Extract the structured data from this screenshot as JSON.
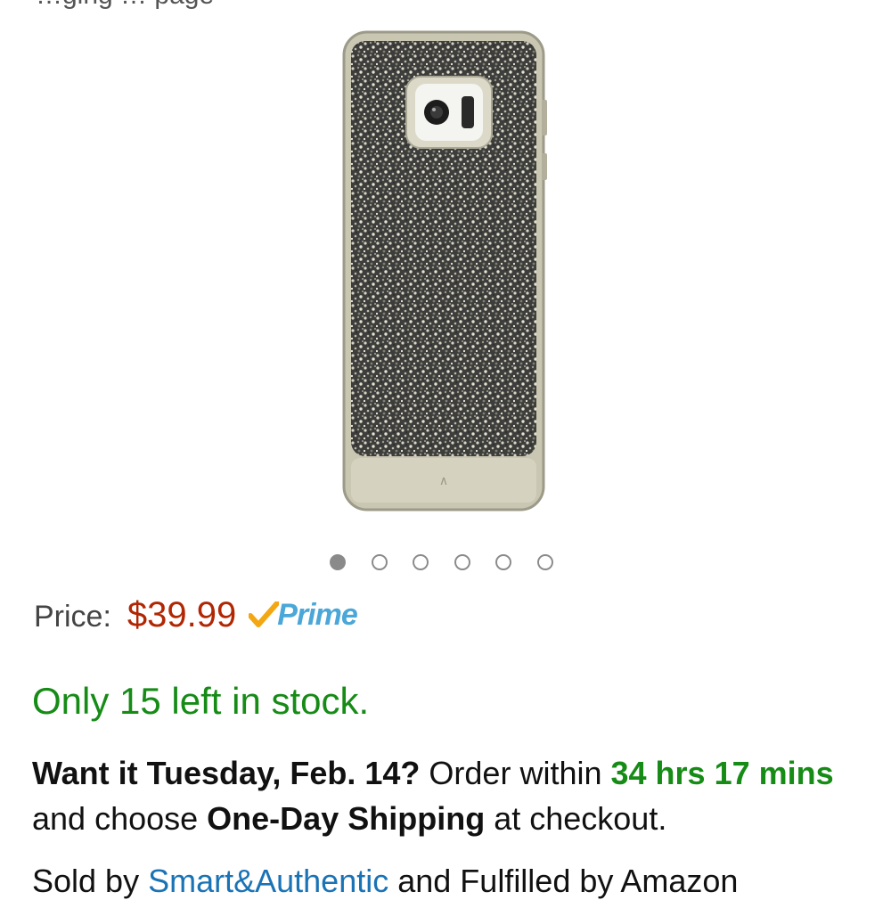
{
  "top_text": "…ging … page",
  "gallery": {
    "image_alt": "Glitter phone case",
    "dots": [
      true,
      false,
      false,
      false,
      false,
      false
    ]
  },
  "price": {
    "label": "Price:",
    "value": "$39.99",
    "badge": "Prime",
    "badge_color": "#4aa7d8",
    "price_color": "#B12704"
  },
  "stock": {
    "text": "Only 15 left in stock.",
    "color": "#168b16"
  },
  "delivery": {
    "want": "Want it Tuesday, Feb. 14?",
    "order_within": "Order within",
    "countdown_hrs": "34 hrs 17",
    "countdown_mins": "mins",
    "choose": "and choose",
    "shipping": "One-Day Shipping",
    "at_checkout": "at checkout."
  },
  "seller": {
    "sold_by": "Sold by",
    "seller_name": "Smart&Authentic",
    "fulfilled": "and Fulfilled by Amazon"
  }
}
